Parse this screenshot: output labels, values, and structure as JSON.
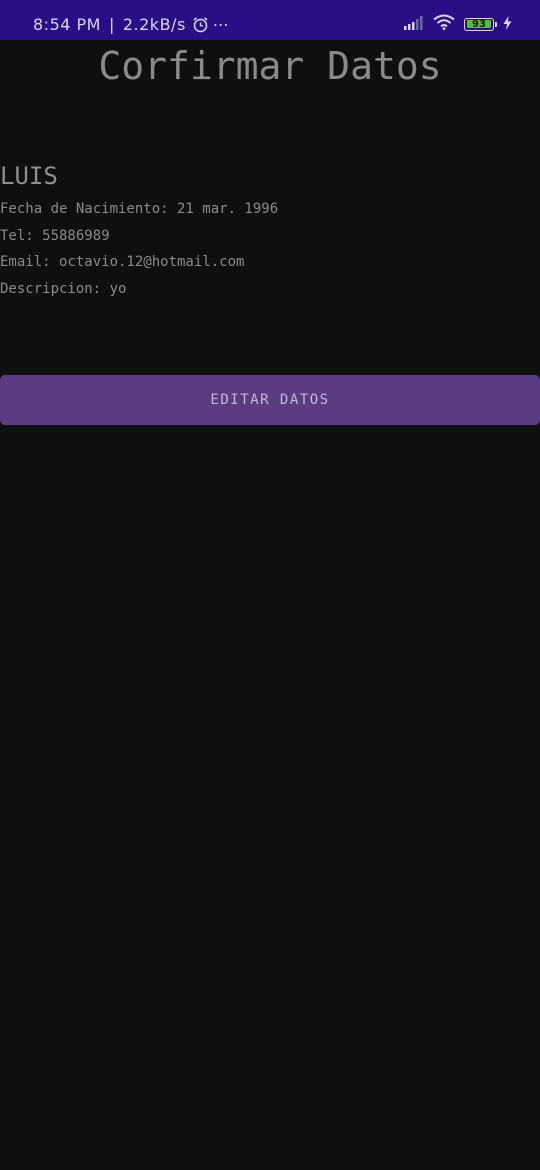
{
  "status_bar": {
    "time": "8:54 PM",
    "separator": "|",
    "network_speed": "2.2kB/s",
    "more": "⋯",
    "battery_level": "93",
    "icons": [
      "alarm-icon",
      "signal-icon",
      "wifi-icon",
      "battery-icon",
      "charging-icon"
    ],
    "background_color": "#2a0e86"
  },
  "page": {
    "title": "Corfirmar Datos"
  },
  "profile": {
    "name": "LUIS",
    "birth_date": "Fecha de Nacimiento: 21 mar. 1996",
    "phone": "Tel: 55886989",
    "email": "Email: octavio.12@hotmail.com",
    "description": "Descripcion: yo"
  },
  "actions": {
    "edit_label": "EDITAR DATOS",
    "button_color": "#5b3b82"
  }
}
